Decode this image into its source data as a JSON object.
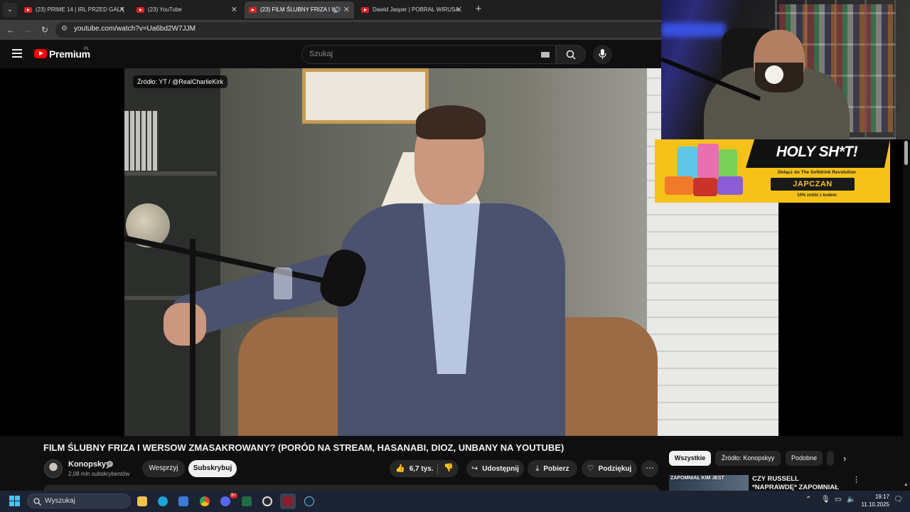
{
  "browser": {
    "tabs": [
      {
        "label": "(23) PRIME 14 | IRL PRZED GALĄ",
        "active": false
      },
      {
        "label": "(23) YouTube",
        "active": false
      },
      {
        "label": "(23) FILM ŚLUBNY FRIZA I W",
        "active": true,
        "audio": true
      },
      {
        "label": "Dawid Jasper | POBRAŁ WIRUSA",
        "active": false
      }
    ],
    "url": "youtube.com/watch?v=Ua6bd2W7JJM"
  },
  "youtube": {
    "logo_text": "Premium",
    "region": "PL",
    "search_placeholder": "Szukaj"
  },
  "video": {
    "source_badge": "Źródło: YT / @RealCharlieKirk",
    "title": "FILM ŚLUBNY FRIZA I WERSOW ZMASAKROWANY? (PORÓD NA STREAM, HASANABI, DIOZ, UNBANY NA YOUTUBE)"
  },
  "channel": {
    "name": "Konopskyy",
    "subscribers": "2,08 mln subskrybentów",
    "support_label": "Wesprzyj",
    "subscribe_label": "Subskrybuj"
  },
  "actions": {
    "likes": "6,7 tys.",
    "share": "Udostępnij",
    "download": "Pobierz",
    "thanks": "Podziękuj"
  },
  "ad": {
    "headline": "HOLY SH*T!",
    "subline": "Dołącz do The Softdrink Revolution",
    "code": "JAPCZAN",
    "discount": "10% zniżki z kodem"
  },
  "chips": [
    {
      "label": "Wszystkie",
      "active": true
    },
    {
      "label": "Źródło: Konopskyy",
      "active": false
    },
    {
      "label": "Podobne",
      "active": false
    }
  ],
  "recommendation": {
    "thumb_text": "ZAPOMNIAŁ KIM JEST",
    "title": "CZY RUSSELL *NAPRAWDĘ* ZAPOMNIAŁ KIM JEST?!"
  },
  "taskbar": {
    "search_placeholder": "Wyszukaj",
    "discord_badge": "9+",
    "time": "19:17",
    "date": "11.10.2025"
  },
  "colors": {
    "youtube_red": "#ff0000",
    "ad_yellow": "#f5c21a",
    "background": "#0f0f0f"
  }
}
